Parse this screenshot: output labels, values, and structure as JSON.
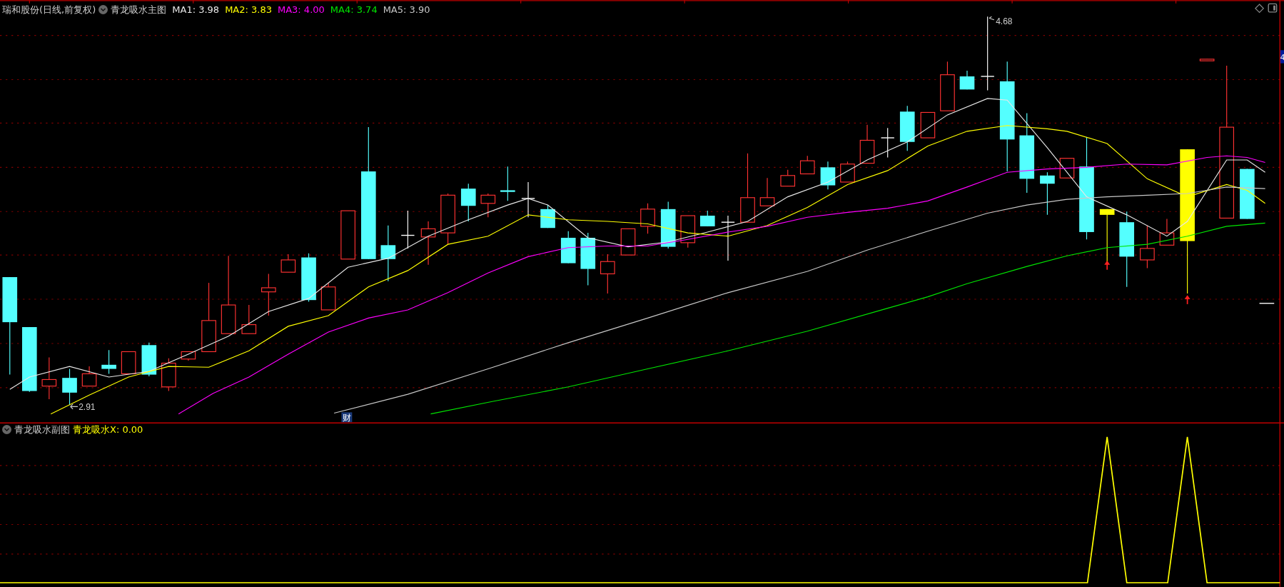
{
  "main_header": {
    "stock": "瑞和股份(日线,前复权)",
    "indicator": "青龙吸水主图",
    "ma": [
      {
        "label": "MA1: 3.98",
        "color": "#e8e8e8"
      },
      {
        "label": "MA2: 3.83",
        "color": "#ffff00"
      },
      {
        "label": "MA3: 4.00",
        "color": "#ff00ff"
      },
      {
        "label": "MA4: 3.74",
        "color": "#00e600"
      },
      {
        "label": "MA5: 3.90",
        "color": "#c8c8c8"
      }
    ]
  },
  "annotations": {
    "high": "4.68",
    "low": "2.91",
    "finance_mark": "财",
    "price_tag": "4"
  },
  "sub_header": {
    "indicator": "青龙吸水副图",
    "value": "青龙吸水X: 0.00"
  }
}
